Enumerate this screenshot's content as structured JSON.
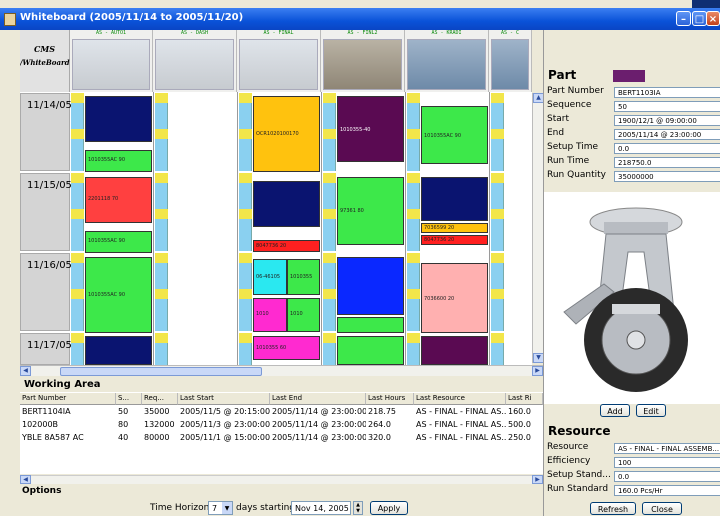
{
  "window": {
    "title": "Whiteboard  (2005/11/14 to 2005/11/20)"
  },
  "grid": {
    "logo": {
      "line1": "CMS",
      "line2": "/WhiteBoard"
    },
    "resources": [
      "AS - AUTO1",
      "AS - DASH",
      "AS - FINAL",
      "AS - FINL2",
      "AS - KRADI",
      "AS - C"
    ],
    "dates": [
      "11/14/05",
      "11/15/05",
      "11/16/05",
      "11/17/05"
    ],
    "blocks": [
      {
        "label": "",
        "color": "#0a1470"
      },
      {
        "label": "1010355AC 90",
        "color": "#3de84a"
      },
      {
        "label": "OCR1020100170",
        "color": "#ffc20e"
      },
      {
        "label": "1010355-40",
        "color": "#5a0a52"
      },
      {
        "label": "1010355AC 90",
        "color": "#3de84a"
      },
      {
        "label": "2201118 70",
        "color": "#ff4040"
      },
      {
        "label": "1010355AC 90",
        "color": "#3de84a"
      },
      {
        "label": "",
        "color": "#0a1470"
      },
      {
        "label": "8047736 20",
        "color": "#ff2020"
      },
      {
        "label": "97361 80",
        "color": "#3de84a"
      },
      {
        "label": "",
        "color": "#0a1470"
      },
      {
        "label": "7036599 20",
        "color": "#ffc20e"
      },
      {
        "label": "8047736 20",
        "color": "#ff2020"
      },
      {
        "label": "1010355AC 90",
        "color": "#3de84a"
      },
      {
        "label": "06-46105",
        "color": "#2ae8f0"
      },
      {
        "label": "1010355",
        "color": "#3de84a"
      },
      {
        "label": "1010",
        "color": "#ff2ad0"
      },
      {
        "label": "1010",
        "color": "#3de84a"
      },
      {
        "label": "",
        "color": "#0a28ff"
      },
      {
        "label": "7036600 20",
        "color": "#ffb0b0"
      },
      {
        "label": "1010355 60",
        "color": "#ff2ad0"
      }
    ]
  },
  "working_area": {
    "title": "Working Area",
    "columns": [
      "Part Number",
      "S...",
      "Req...",
      "Last Start",
      "Last End",
      "Last Hours",
      "Last Resource",
      "Last Ri"
    ],
    "rows": [
      [
        "BERT1104IA",
        "50",
        "35000",
        "2005/11/5 @ 20:15:00",
        "2005/11/14 @ 23:00:00",
        "218.75",
        "AS - FINAL - FINAL AS...",
        "160.0"
      ],
      [
        "102000B",
        "80",
        "132000",
        "2005/11/3 @ 23:00:00",
        "2005/11/14 @ 23:00:00",
        "264.0",
        "AS - FINAL - FINAL AS...",
        "500.0"
      ],
      [
        "YBLE 8A587 AC",
        "40",
        "80000",
        "2005/11/1 @ 15:00:00",
        "2005/11/14 @ 23:00:00",
        "320.0",
        "AS - FINAL - FINAL AS...",
        "250.0"
      ]
    ]
  },
  "options": {
    "title": "Options",
    "time_horizon_label": "Time Horizon:",
    "time_horizon_value": "7",
    "days_starting_label": "days  starting",
    "start_date": "Nov 14, 2005",
    "apply_label": "Apply"
  },
  "part": {
    "title": "Part",
    "swatch_color": "#6b1e6e",
    "fields": [
      {
        "label": "Part Number",
        "value": "BERT1103IA"
      },
      {
        "label": "Sequence",
        "value": "50"
      },
      {
        "label": "Start",
        "value": "1900/12/1 @ 09:00:00"
      },
      {
        "label": "End",
        "value": "2005/11/14 @ 23:00:00"
      },
      {
        "label": "Setup Time",
        "value": "0.0"
      },
      {
        "label": "Run Time",
        "value": "218750.0"
      },
      {
        "label": "Run Quantity",
        "value": "35000000"
      }
    ],
    "add_label": "Add",
    "edit_label": "Edit"
  },
  "resource": {
    "title": "Resource",
    "fields": [
      {
        "label": "Resource",
        "value": "AS - FINAL - FINAL ASSEMB..."
      },
      {
        "label": "Efficiency",
        "value": "100"
      },
      {
        "label": "Setup Stand...",
        "value": "0.0"
      },
      {
        "label": "Run Standard",
        "value": "160.0 Pcs/Hr"
      }
    ],
    "refresh_label": "Refresh",
    "close_label": "Close"
  },
  "icons": {
    "minimize": "minimize-icon",
    "maximize": "maximize-icon",
    "close": "close-icon",
    "scroll_up": "arrow-up-icon",
    "scroll_down": "arrow-down-icon",
    "scroll_left": "arrow-left-icon",
    "scroll_right": "arrow-right-icon",
    "spinner": "spinner-arrows-icon",
    "dropdown": "chevron-down-icon"
  }
}
